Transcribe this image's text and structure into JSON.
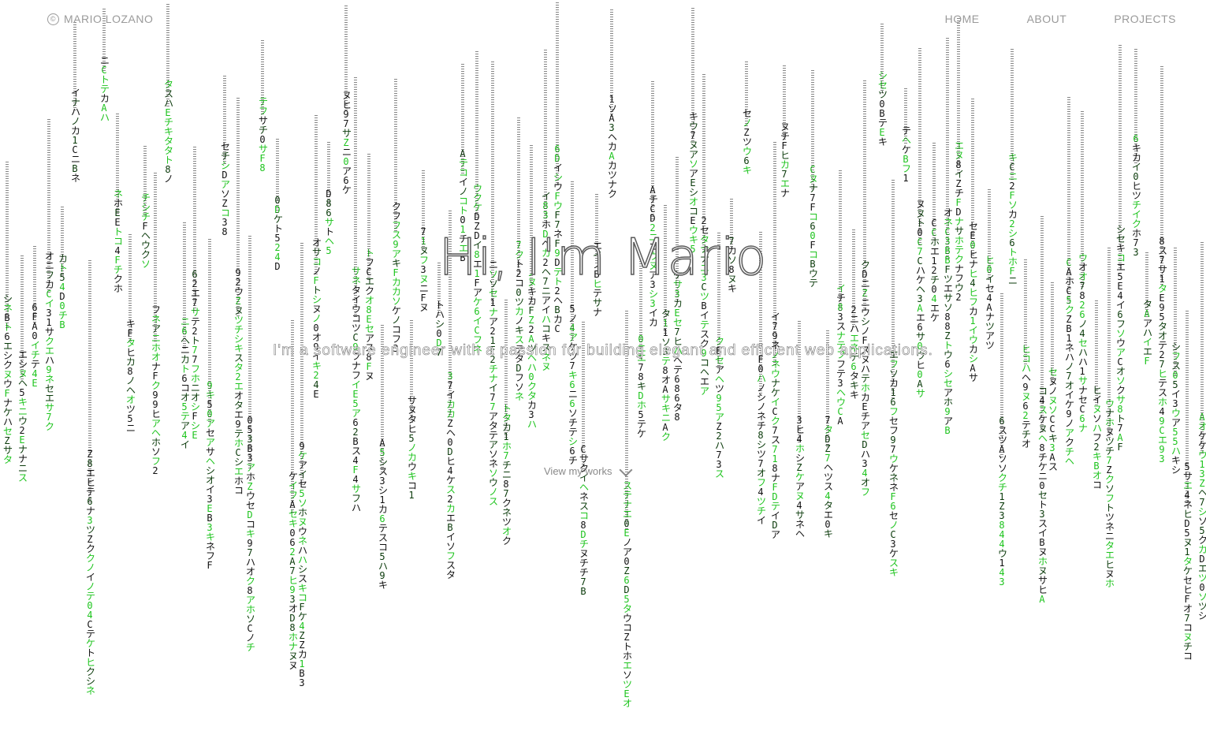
{
  "brand": {
    "symbol": "©",
    "name": "MARIO LOZANO"
  },
  "nav": {
    "items": [
      {
        "label": "HOME"
      },
      {
        "label": "ABOUT"
      },
      {
        "label": "PROJECTS"
      }
    ]
  },
  "hero": {
    "title": "Hi, I'm Mario",
    "subtitle": "I'm a software engineer with a passion for building elegant and efficient web applications.",
    "cta_label": "View my works",
    "cta_icon": "chevron-down-icon"
  },
  "theme": {
    "background": "#ffffff",
    "rain_color": "#111111",
    "rain_accent": "#1ec41e",
    "nav_text": "#9a9a9a"
  }
}
